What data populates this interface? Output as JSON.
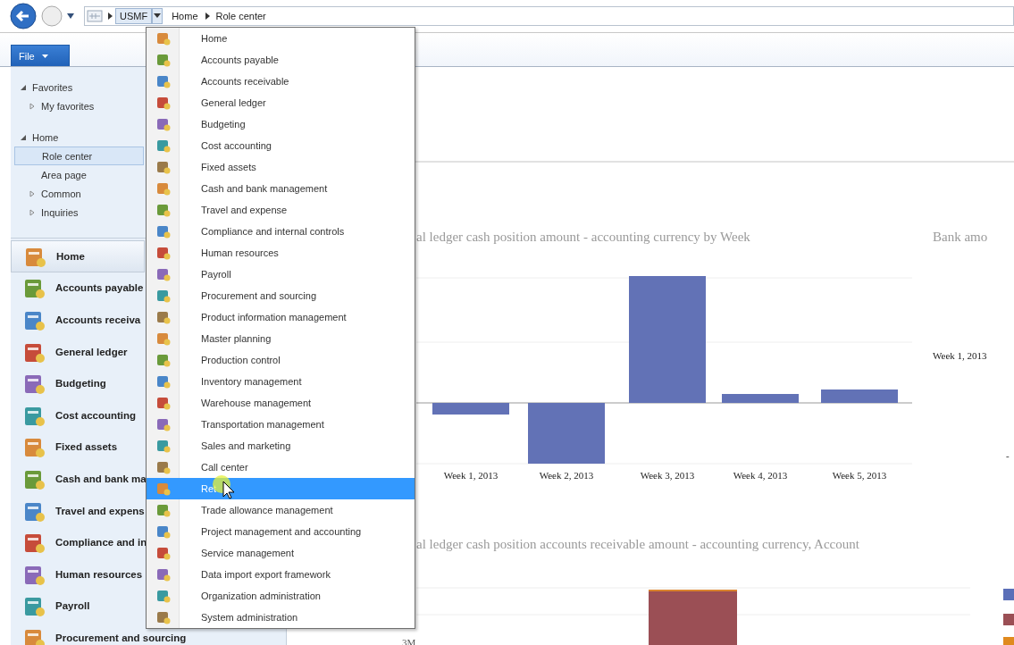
{
  "address_bar": {
    "company": "USMF",
    "breadcrumb": [
      "Home",
      "Role center"
    ]
  },
  "file_button": {
    "label": "File"
  },
  "navigation_tree": [
    {
      "label": "Favorites",
      "expanded": true,
      "selected": false,
      "children": [
        {
          "label": "My favorites",
          "expanded": false,
          "selected": false
        }
      ]
    },
    {
      "label": "Home",
      "expanded": true,
      "selected": false,
      "children": [
        {
          "label": "Role center",
          "selected": true
        },
        {
          "label": "Area page",
          "selected": false
        },
        {
          "label": "Common",
          "expanded": false,
          "selected": false
        },
        {
          "label": "Inquiries",
          "expanded": false,
          "selected": false
        }
      ]
    }
  ],
  "modules": [
    {
      "label": "Home",
      "selected": true
    },
    {
      "label": "Accounts payable",
      "selected": false
    },
    {
      "label": "Accounts receiva",
      "selected": false
    },
    {
      "label": "General ledger",
      "selected": false
    },
    {
      "label": "Budgeting",
      "selected": false
    },
    {
      "label": "Cost accounting",
      "selected": false
    },
    {
      "label": "Fixed assets",
      "selected": false
    },
    {
      "label": "Cash and bank ma",
      "selected": false
    },
    {
      "label": "Travel and expens",
      "selected": false
    },
    {
      "label": "Compliance and in",
      "selected": false
    },
    {
      "label": "Human resources",
      "selected": false
    },
    {
      "label": "Payroll",
      "selected": false
    },
    {
      "label": "Procurement and sourcing",
      "selected": false
    }
  ],
  "module_menu": {
    "items": [
      {
        "label": "Home",
        "selected": false
      },
      {
        "label": "Accounts payable",
        "selected": false
      },
      {
        "label": "Accounts receivable",
        "selected": false
      },
      {
        "label": "General ledger",
        "selected": false
      },
      {
        "label": "Budgeting",
        "selected": false
      },
      {
        "label": "Cost accounting",
        "selected": false
      },
      {
        "label": "Fixed assets",
        "selected": false
      },
      {
        "label": "Cash and bank management",
        "selected": false
      },
      {
        "label": "Travel and expense",
        "selected": false
      },
      {
        "label": "Compliance and internal controls",
        "selected": false
      },
      {
        "label": "Human resources",
        "selected": false
      },
      {
        "label": "Payroll",
        "selected": false
      },
      {
        "label": "Procurement and sourcing",
        "selected": false
      },
      {
        "label": "Product information management",
        "selected": false
      },
      {
        "label": "Master planning",
        "selected": false
      },
      {
        "label": "Production control",
        "selected": false
      },
      {
        "label": "Inventory management",
        "selected": false
      },
      {
        "label": "Warehouse management",
        "selected": false
      },
      {
        "label": "Transportation management",
        "selected": false
      },
      {
        "label": "Sales and marketing",
        "selected": false
      },
      {
        "label": "Call center",
        "selected": false
      },
      {
        "label": "Ret",
        "selected": true
      },
      {
        "label": "Trade allowance management",
        "selected": false
      },
      {
        "label": "Project management and accounting",
        "selected": false
      },
      {
        "label": "Service management",
        "selected": false
      },
      {
        "label": "Data import export framework",
        "selected": false
      },
      {
        "label": "Organization administration",
        "selected": false
      },
      {
        "label": "System administration",
        "selected": false
      }
    ]
  },
  "charts": [
    {
      "title": "al ledger cash position amount - accounting currency by Week",
      "x_labels": [
        "Week 1, 2013",
        "Week 2, 2013",
        "Week 3, 2013",
        "Week 4, 2013",
        "Week 5, 2013"
      ]
    },
    {
      "title": "al ledger cash position accounts receivable amount - accounting currency, Account",
      "axis_label": "3M"
    }
  ],
  "bank_panel": {
    "title": "Bank amo",
    "label": "Week 1, 2013",
    "mark": "-"
  }
}
